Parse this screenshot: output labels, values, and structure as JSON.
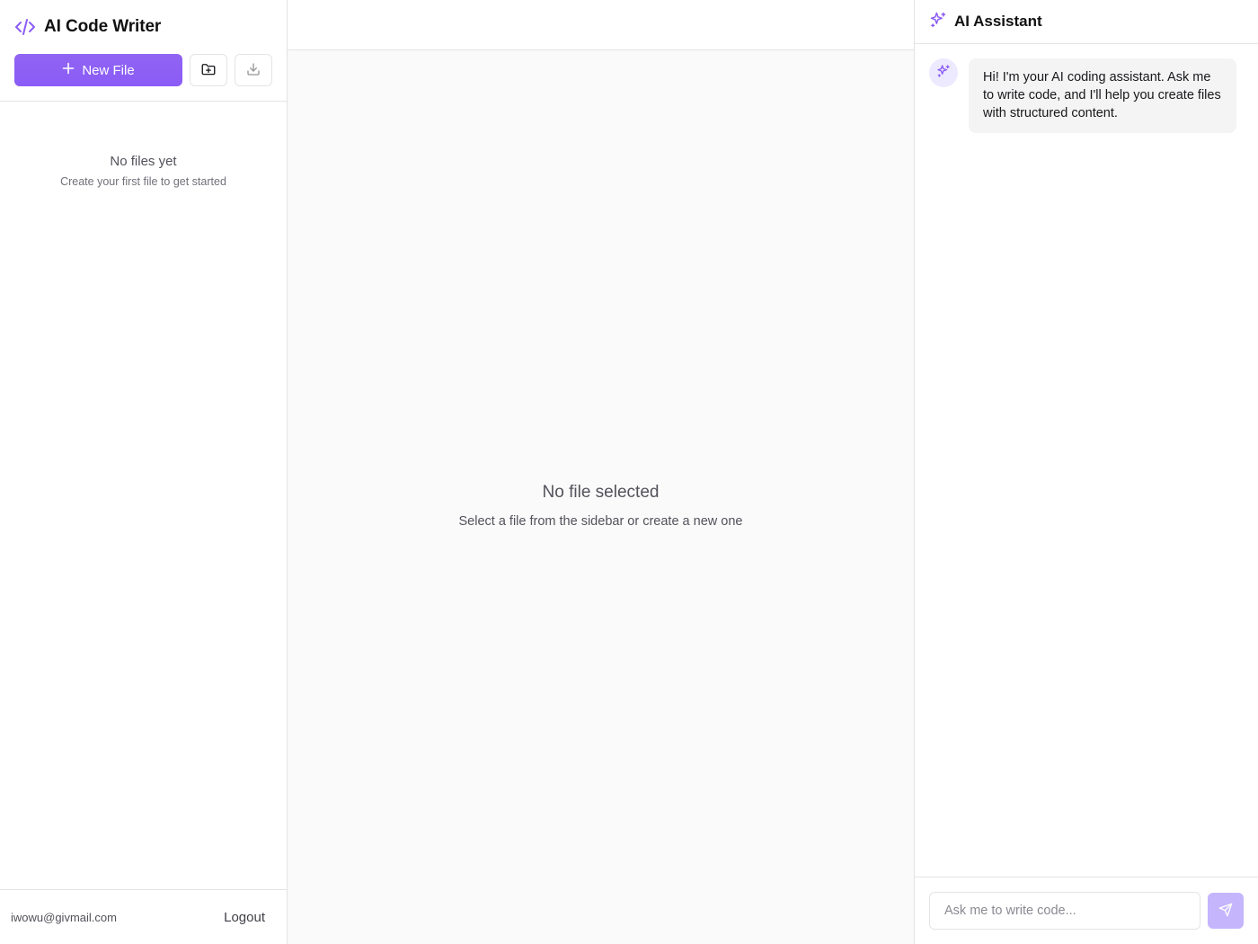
{
  "colors": {
    "accent": "#8b5cf6",
    "accent_light": "#ede9fe",
    "send_disabled": "#c4b5fd",
    "border": "#e4e4e7",
    "editor_bg": "#fafafa"
  },
  "sidebar": {
    "brand": {
      "icon": "code-icon",
      "title": "AI Code Writer"
    },
    "actions": {
      "new_file_label": "New File",
      "new_file_icon": "plus-icon",
      "new_folder_icon": "folder-plus-icon",
      "download_icon": "download-icon"
    },
    "empty_state": {
      "title": "No files yet",
      "subtitle": "Create your first file to get started"
    },
    "footer": {
      "email": "iwowu@givmail.com",
      "logout_label": "Logout"
    }
  },
  "editor": {
    "empty_state": {
      "title": "No file selected",
      "subtitle": "Select a file from the sidebar or create a new one"
    }
  },
  "assistant": {
    "header": {
      "icon": "sparkles-icon",
      "title": "AI Assistant"
    },
    "messages": [
      {
        "role": "assistant",
        "avatar_icon": "sparkles-icon",
        "text": "Hi! I'm your AI coding assistant. Ask me to write code, and I'll help you create files with structured content."
      }
    ],
    "composer": {
      "placeholder": "Ask me to write code...",
      "value": "",
      "send_icon": "send-icon"
    }
  }
}
